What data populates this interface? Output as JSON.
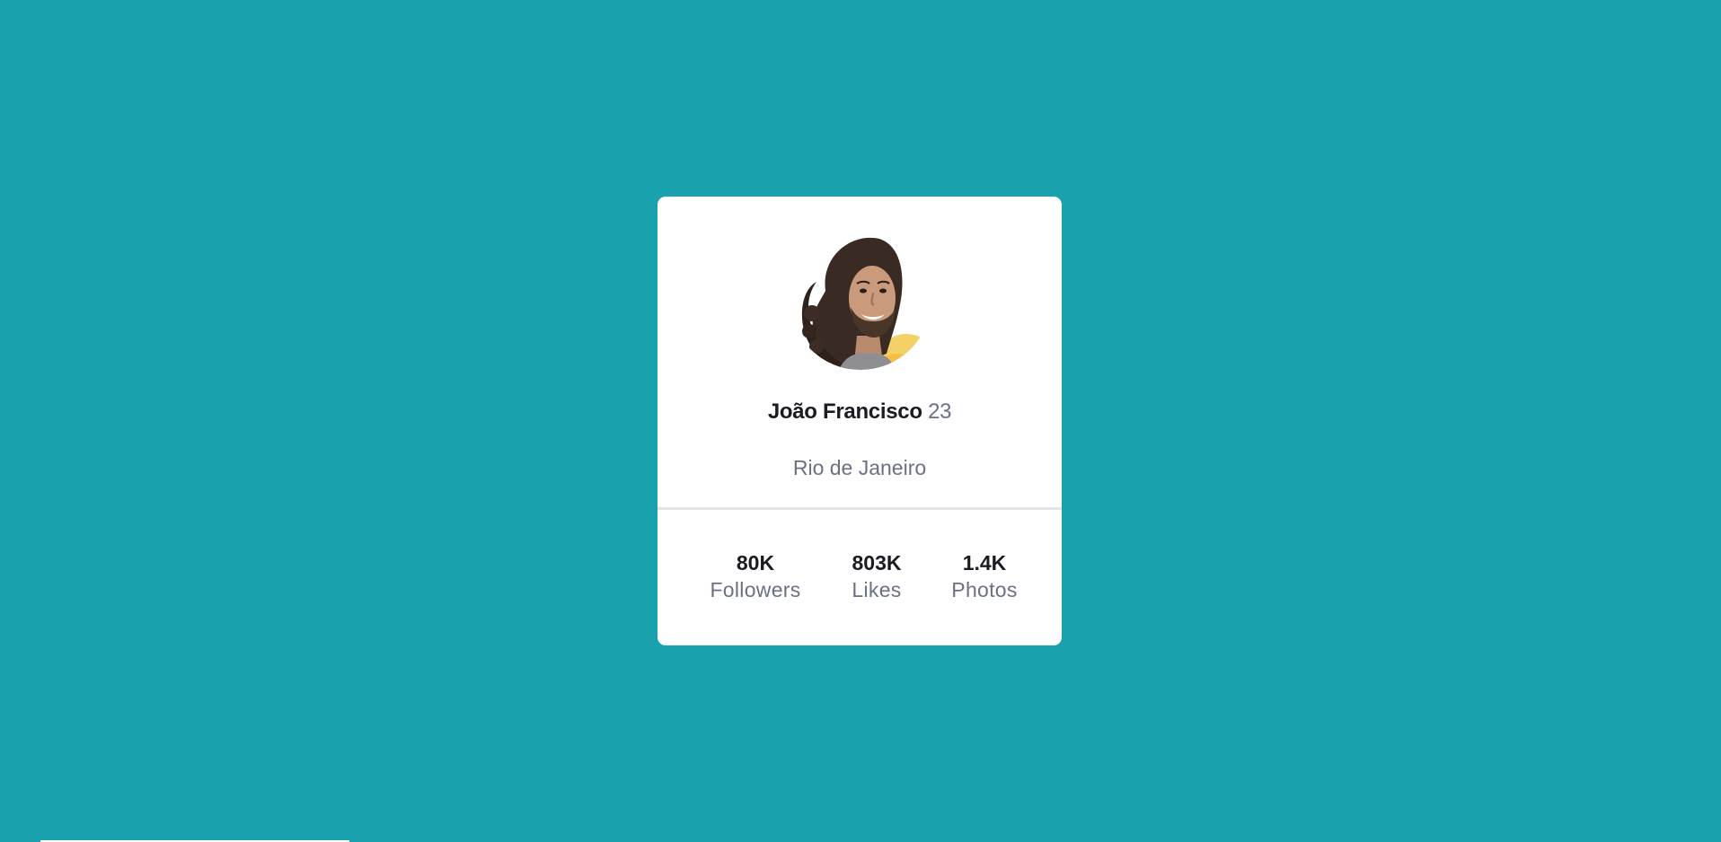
{
  "profile": {
    "name": "João Francisco",
    "age": "23",
    "location": "Rio de Janeiro",
    "avatar_alt": "profile-photo"
  },
  "stats": [
    {
      "value": "80K",
      "label": "Followers"
    },
    {
      "value": "803K",
      "label": "Likes"
    },
    {
      "value": "1.4K",
      "label": "Photos"
    }
  ],
  "colors": {
    "background": "#19a2ae",
    "card": "#ffffff",
    "primary_text": "#1b1b24",
    "secondary_text": "#6b7082",
    "divider": "#e2e4e7"
  }
}
